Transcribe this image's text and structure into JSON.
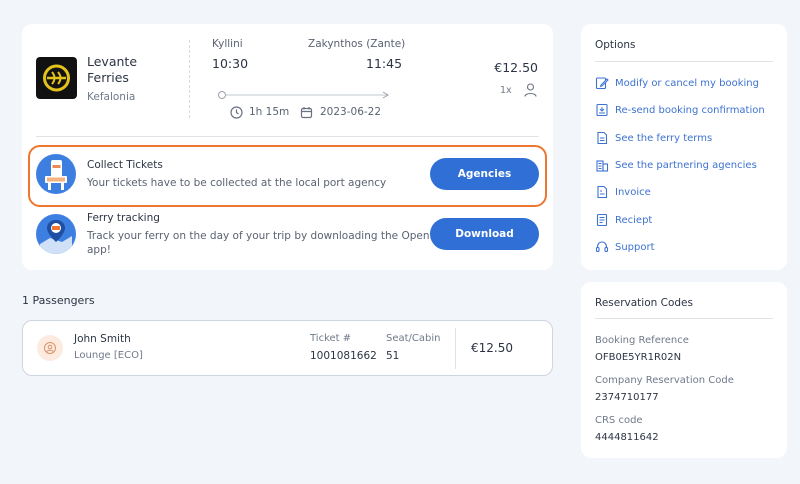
{
  "trip": {
    "operator_line1": "Levante",
    "operator_line2": "Ferries",
    "operator_sub": "Kefalonia",
    "departure_port": "Kyllini",
    "arrival_port": "Zakynthos (Zante)",
    "departure_time": "10:30",
    "arrival_time": "11:45",
    "duration": "1h 15m",
    "date": "2023-06-22",
    "price": "€12.50",
    "passenger_count": "1x"
  },
  "collect": {
    "title": "Collect Tickets",
    "description": "Your tickets have to be collected at the local port agency",
    "button": "Agencies"
  },
  "tracking": {
    "title": "Ferry tracking",
    "description_line1": "Track your ferry on the day of your trip by downloading the Openferry",
    "description_line2": "app!",
    "button": "Download"
  },
  "passengers": {
    "heading": "1 Passengers",
    "name": "John Smith",
    "class": "Lounge [ECO]",
    "ticket_label": "Ticket #",
    "ticket_value": "1001081662",
    "seat_label": "Seat/Cabin",
    "seat_value": "51",
    "price": "€12.50"
  },
  "options": {
    "title": "Options",
    "items": [
      {
        "label": "Modify or cancel my booking",
        "icon": "edit-icon"
      },
      {
        "label": "Re-send booking confirmation",
        "icon": "resend-icon"
      },
      {
        "label": "See the ferry terms",
        "icon": "document-icon"
      },
      {
        "label": "See the partnering agencies",
        "icon": "building-icon"
      },
      {
        "label": "Invoice",
        "icon": "invoice-icon"
      },
      {
        "label": "Reciept",
        "icon": "receipt-icon"
      },
      {
        "label": "Support",
        "icon": "headset-icon"
      }
    ]
  },
  "codes": {
    "title": "Reservation Codes",
    "booking_ref_label": "Booking Reference",
    "booking_ref_value": "OFB0E5YR1R02N",
    "company_code_label": "Company Reservation Code",
    "company_code_value": "2374710177",
    "crs_label": "CRS code",
    "crs_value": "4444811642"
  },
  "colors": {
    "accent": "#2f6fd6",
    "link": "#3d72d0",
    "highlight": "#ee7630",
    "background": "#f2f5f9"
  }
}
